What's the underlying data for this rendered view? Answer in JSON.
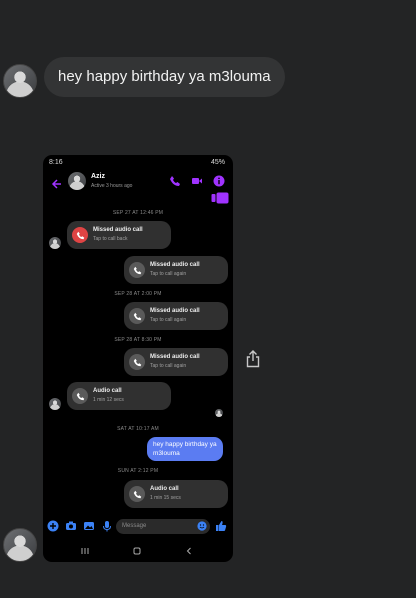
{
  "outer": {
    "message": "hey happy birthday ya m3louma"
  },
  "phone": {
    "status_time": "8:16",
    "status_battery": "45%",
    "contact_name": "Aziz",
    "contact_status": "Active 3 hours ago",
    "stamps": [
      "SEP 27 AT 12:46 PM",
      "SEP 28 AT 2:00 PM",
      "SEP 28 AT 8:30 PM",
      "SAT AT 10:17 AM",
      "SUN AT 2:12 PM"
    ],
    "items": [
      {
        "title": "Missed audio call",
        "sub": "Tap to call back"
      },
      {
        "title": "Missed audio call",
        "sub": "Tap to call again"
      },
      {
        "title": "Missed audio call",
        "sub": "Tap to call again"
      },
      {
        "title": "Missed audio call",
        "sub": "Tap to call again"
      },
      {
        "title": "Audio call",
        "sub": "1 min 12 secs"
      },
      {
        "title": "Audio call",
        "sub": "1 min 15 secs"
      }
    ],
    "sent_message": "hey happy birthday ya m3louma",
    "composer_placeholder": "Message"
  },
  "colors": {
    "accent": "#a033ff",
    "sent_bubble": "#5b7cf2",
    "missed_icon": "#e04444",
    "composer_blue": "#3b82f6"
  }
}
